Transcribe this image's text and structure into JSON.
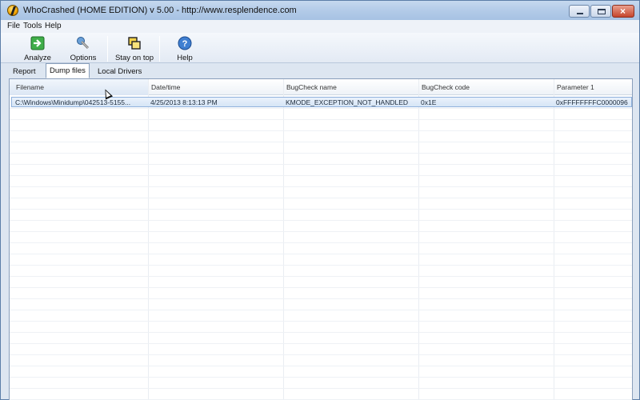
{
  "window": {
    "title": "WhoCrashed  (HOME EDITION)  v 5.00  -  http://www.resplendence.com"
  },
  "menu": {
    "items": [
      "File",
      "Tools",
      "Help"
    ]
  },
  "toolbar": {
    "analyze_label": "Analyze",
    "options_label": "Options",
    "stay_on_top_label": "Stay on top",
    "help_label": "Help"
  },
  "tabs": {
    "items": [
      "Report",
      "Dump files",
      "Local Drivers"
    ],
    "active": "Dump files"
  },
  "table": {
    "columns": [
      "Filename",
      "Date/time",
      "BugCheck name",
      "BugCheck code",
      "Parameter 1"
    ],
    "rows": [
      {
        "filename": "C:\\Windows\\Minidump\\042513-5155...",
        "datetime": "4/25/2013 8:13:13 PM",
        "bugcheck_name": "KMODE_EXCEPTION_NOT_HANDLED",
        "bugcheck_code": "0x1E",
        "parameter1": "0xFFFFFFFFC0000096"
      }
    ]
  },
  "colors": {
    "selection": "#d6e5f6",
    "titlebar": "#b3cbe8",
    "close_button": "#c5452c"
  },
  "icons": {
    "app": "whocrashed-app-icon",
    "analyze": "green-arrow-icon",
    "options": "wrench-icon",
    "stay_on_top": "windows-stack-icon",
    "help": "question-icon"
  }
}
